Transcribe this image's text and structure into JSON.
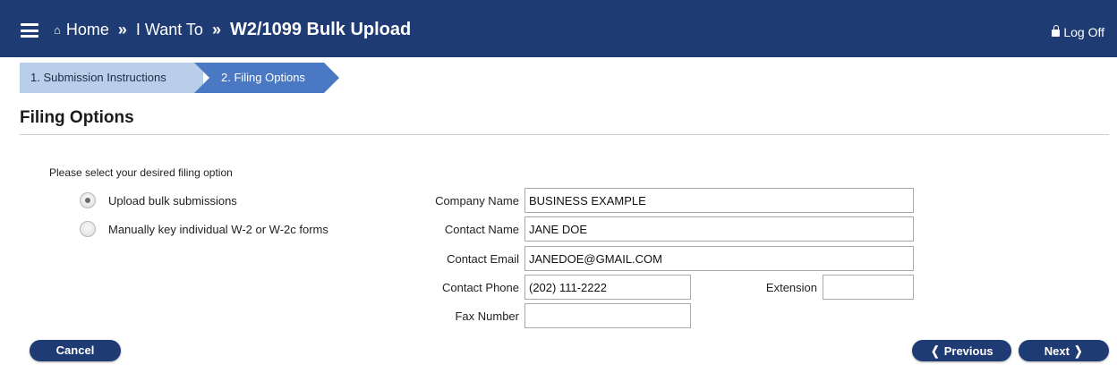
{
  "header": {
    "home_icon": "home-icon",
    "home_label": "Home",
    "separator": "»",
    "crumb_2": "I Want To",
    "current": "W2/1099 Bulk Upload",
    "logoff_label": "Log Off",
    "bar_color": "#1f3b73"
  },
  "steps": [
    {
      "label": "1. Submission Instructions",
      "state": "completed"
    },
    {
      "label": "2. Filing Options",
      "state": "active"
    }
  ],
  "page": {
    "title": "Filing Options",
    "prompt": "Please select your desired filing option"
  },
  "options": [
    {
      "label": "Upload bulk submissions",
      "selected": true
    },
    {
      "label": "Manually key individual W-2 or W-2c forms",
      "selected": false
    }
  ],
  "form": {
    "company_name": {
      "label": "Company Name",
      "value": "BUSINESS EXAMPLE"
    },
    "contact_name": {
      "label": "Contact Name",
      "value": "JANE DOE"
    },
    "contact_email": {
      "label": "Contact Email",
      "value": "JANEDOE@GMAIL.COM"
    },
    "contact_phone": {
      "label": "Contact Phone",
      "value": "(202) 111-2222"
    },
    "extension": {
      "label": "Extension",
      "value": ""
    },
    "fax_number": {
      "label": "Fax Number",
      "value": ""
    }
  },
  "buttons": {
    "cancel": "Cancel",
    "previous": "Previous",
    "next": "Next"
  }
}
